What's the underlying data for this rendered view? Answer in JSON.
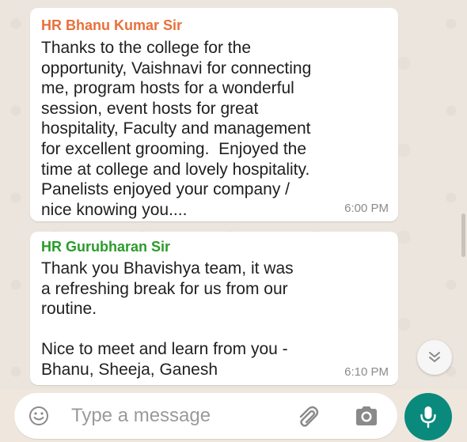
{
  "messages": [
    {
      "sender": "HR Bhanu Kumar Sir",
      "text": "Thanks to the college for the\nopportunity, Vaishnavi for connecting\nme, program hosts for a wonderful\nsession, event hosts for great\nhospitality, Faculty and management\nfor excellent grooming.  Enjoyed the\ntime at college and lovely hospitality.\nPanelists enjoyed your company /\nnice knowing you....",
      "time": "6:00 PM",
      "sender_color": "#e8703b"
    },
    {
      "sender": "HR Gurubharan Sir",
      "text": "Thank you Bhavishya team, it was\na refreshing break for us from our\nroutine.\n\nNice to meet and learn from you -\nBhanu, Sheeja, Ganesh",
      "time": "6:10 PM",
      "sender_color": "#2a9b2a"
    }
  ],
  "composer": {
    "placeholder": "Type a message"
  },
  "icons": {
    "emoji": "emoji-icon",
    "attach": "paperclip-icon",
    "camera": "camera-icon",
    "mic": "microphone-icon",
    "scroll_down": "double-chevron-down-icon"
  },
  "colors": {
    "background": "#ece5dd",
    "mic_button": "#0a8a7c"
  }
}
